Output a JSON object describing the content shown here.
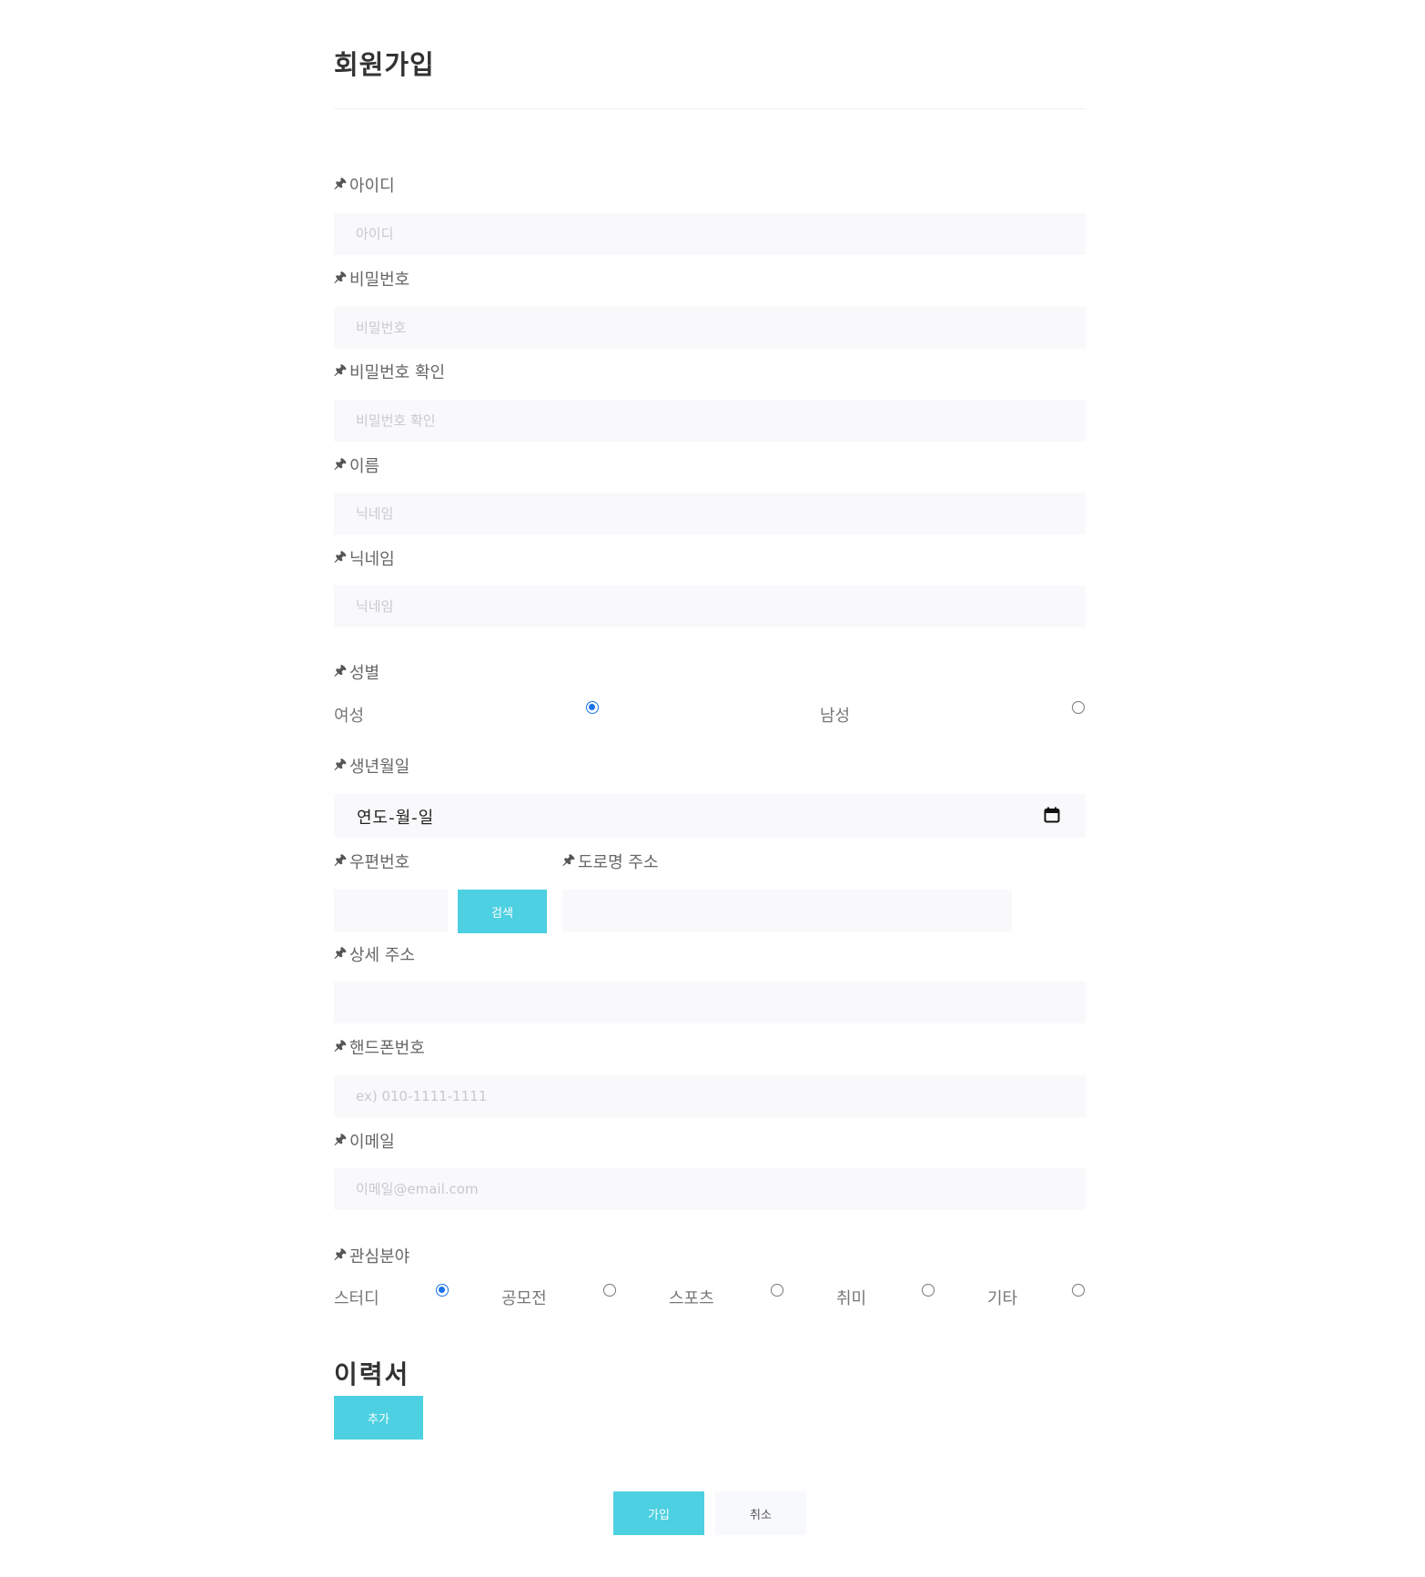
{
  "page": {
    "title": "회원가입"
  },
  "fields": {
    "username": {
      "label": "아이디",
      "placeholder": "아이디"
    },
    "password": {
      "label": "비밀번호",
      "placeholder": "비밀번호"
    },
    "password_confirm": {
      "label": "비밀번호 확인",
      "placeholder": "비밀번호 확인"
    },
    "name": {
      "label": "이름",
      "placeholder": "닉네임"
    },
    "nickname": {
      "label": "닉네임",
      "placeholder": "닉네임"
    },
    "gender": {
      "label": "성별",
      "options": [
        {
          "label": "여성",
          "checked": true
        },
        {
          "label": "남성",
          "checked": false
        }
      ]
    },
    "birthdate": {
      "label": "생년월일",
      "value": "연도-월-일"
    },
    "postal_code": {
      "label": "우편번호",
      "search_button": "검색"
    },
    "road_address": {
      "label": "도로명 주소"
    },
    "detail_address": {
      "label": "상세 주소"
    },
    "phone": {
      "label": "핸드폰번호",
      "placeholder": "ex) 010-1111-1111"
    },
    "email": {
      "label": "이메일",
      "placeholder": "이메일@email.com"
    },
    "interests": {
      "label": "관심분야",
      "options": [
        {
          "label": "스터디",
          "checked": true
        },
        {
          "label": "공모전",
          "checked": false
        },
        {
          "label": "스포츠",
          "checked": false
        },
        {
          "label": "취미",
          "checked": false
        },
        {
          "label": "기타",
          "checked": false
        }
      ]
    }
  },
  "resume": {
    "title": "이력서",
    "add_button": "추가"
  },
  "actions": {
    "submit": "가입",
    "cancel": "취소"
  },
  "colors": {
    "accent": "#4dd0e1",
    "input_bg": "#f9f9fc",
    "radio_checked": "#1a73e8"
  },
  "icons": {
    "required": "pin-icon",
    "date_picker": "calendar-icon"
  }
}
